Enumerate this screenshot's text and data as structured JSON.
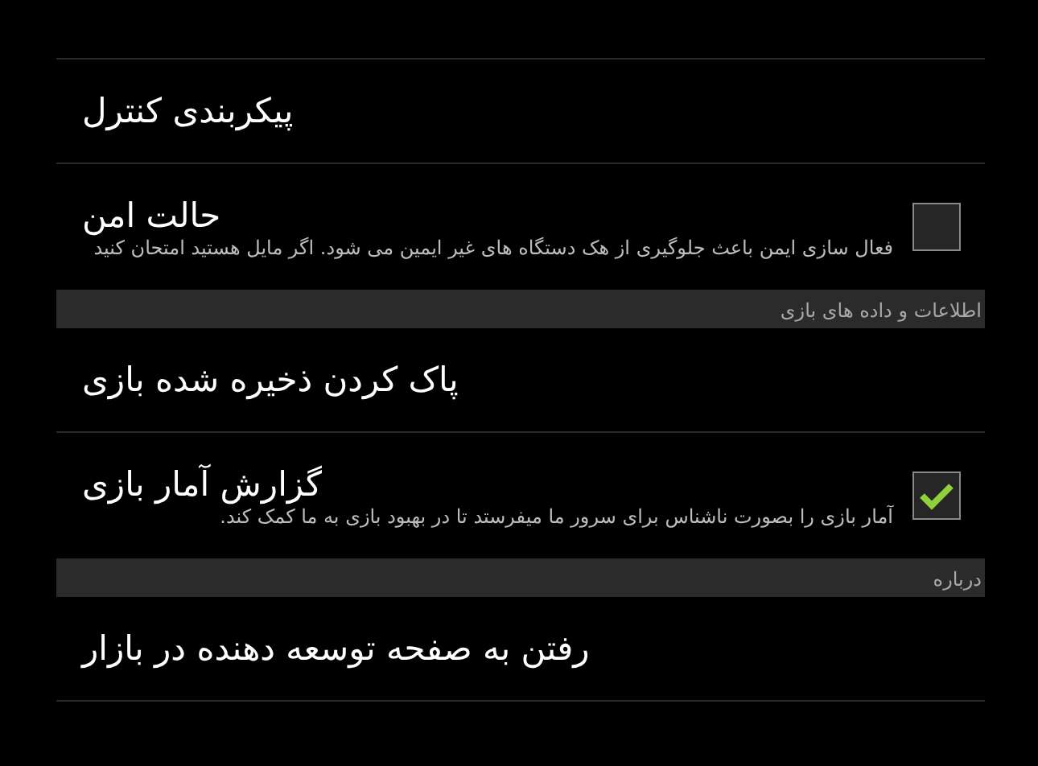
{
  "preferences": [
    {
      "kind": "item",
      "title": "پیکربندی کنترل"
    },
    {
      "kind": "toggle",
      "title": "حالت امن",
      "summary": "فعال سازی ایمن باعث جلوگیری از هک دستگاه های غیر ایمین می شود. اگر مایل هستید امتحان کنید",
      "checked": false
    },
    {
      "kind": "header",
      "title": "اطلاعات و داده های بازی"
    },
    {
      "kind": "item",
      "title": "پاک کردن ذخیره شده بازی"
    },
    {
      "kind": "toggle",
      "title": "گزارش آمار بازی",
      "summary": "آمار بازی را بصورت ناشناس برای سرور ما میفرستد تا در بهبود بازی به ما کمک کند.",
      "checked": true
    },
    {
      "kind": "header",
      "title": "درباره"
    },
    {
      "kind": "item",
      "title": "رفتن به صفحه توسعه دهنده در بازار"
    }
  ]
}
